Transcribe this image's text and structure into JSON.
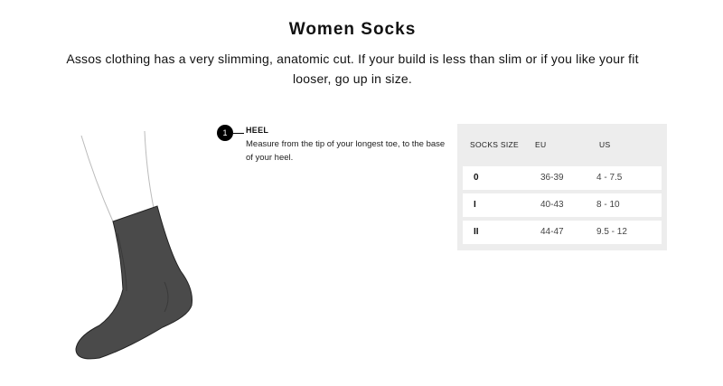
{
  "page": {
    "title": "Women Socks",
    "subtitle": "Assos clothing has a very slimming, anatomic cut. If your build is less than slim or if you like your fit looser, go up in size."
  },
  "measurement": {
    "number": "1",
    "title": "HEEL",
    "description": "Measure from the tip of your longest toe, to the base of your heel."
  },
  "size_table": {
    "headers": [
      "SOCKS SIZE",
      "EU",
      "US"
    ],
    "rows": [
      {
        "size": "0",
        "eu": "36-39",
        "us": "4 - 7.5"
      },
      {
        "size": "I",
        "eu": "40-43",
        "us": "8 - 10"
      },
      {
        "size": "II",
        "eu": "44-47",
        "us": "9.5 - 12"
      }
    ]
  },
  "colors": {
    "sock": "#4a4a4a",
    "panel": "#ededed",
    "marker": "#000000"
  }
}
